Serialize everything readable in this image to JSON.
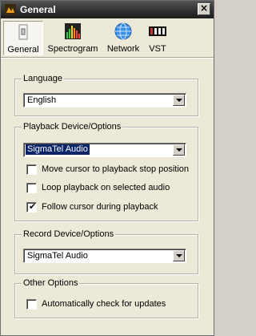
{
  "window": {
    "title": "General",
    "app_icon": "audio-app-icon",
    "close_glyph": "×"
  },
  "toolbar": {
    "items": [
      {
        "label": "General",
        "icon": "switch-icon",
        "active": true
      },
      {
        "label": "Spectrogram",
        "icon": "spectrogram-icon",
        "active": false
      },
      {
        "label": "Network",
        "icon": "globe-icon",
        "active": false
      },
      {
        "label": "VST",
        "icon": "vst-icon",
        "active": false
      }
    ]
  },
  "language": {
    "title": "Language",
    "selected": "English"
  },
  "playback": {
    "title": "Playback Device/Options",
    "selected": "SigmaTel Audio",
    "options": [
      {
        "label": "Move cursor to playback stop position",
        "checked": false
      },
      {
        "label": "Loop playback on selected audio",
        "checked": false
      },
      {
        "label": "Follow cursor during playback",
        "checked": true
      }
    ]
  },
  "record": {
    "title": "Record Device/Options",
    "selected": "SigmaTel Audio"
  },
  "other": {
    "title": "Other Options",
    "options": [
      {
        "label": "Automatically check for updates",
        "checked": false
      }
    ]
  },
  "check_glyph": "✔"
}
